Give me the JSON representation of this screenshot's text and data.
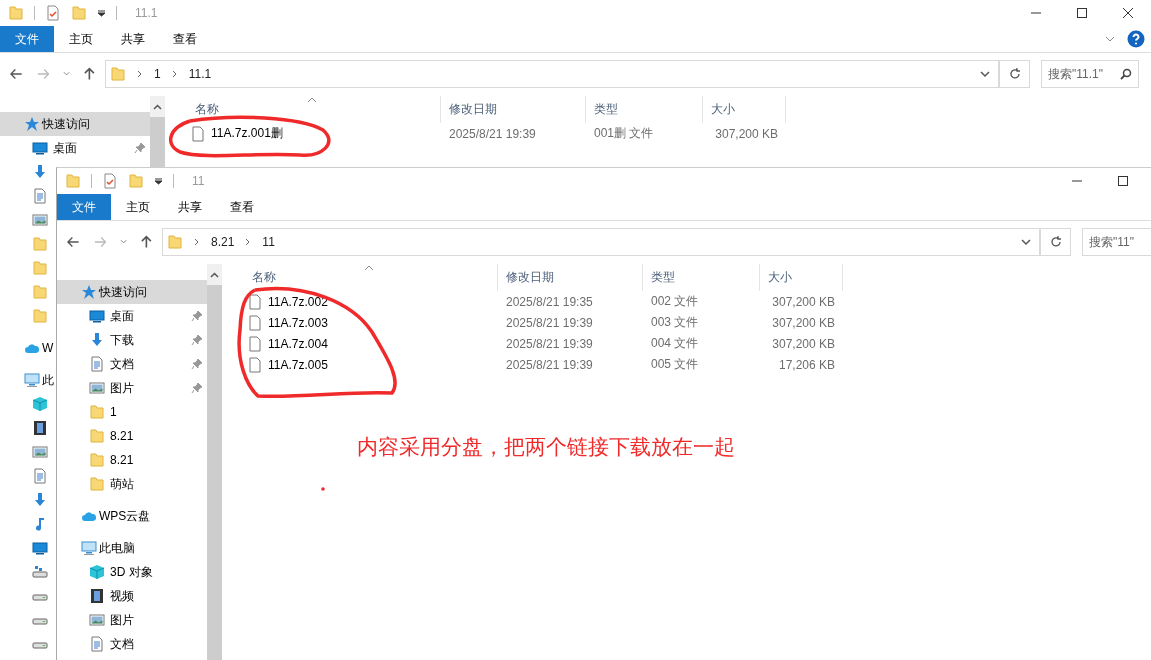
{
  "back_window": {
    "title": "11.1",
    "ribbon_controls": true,
    "ribbon_tabs": [
      {
        "label": "文件",
        "selected": true
      },
      {
        "label": "主页",
        "selected": false
      },
      {
        "label": "共享",
        "selected": false
      },
      {
        "label": "查看",
        "selected": false
      }
    ],
    "breadcrumb": [
      "1",
      "11.1"
    ],
    "search": {
      "placeholder": "搜索\"11.1\""
    },
    "nav": [
      {
        "kind": "star",
        "label": "快速访问",
        "selected": true,
        "children": [
          {
            "kind": "desktop",
            "label": "桌面",
            "selected": false,
            "pinned": true
          },
          {
            "kind": "download",
            "selected": false,
            "pinned": false
          },
          {
            "kind": "document",
            "selected": false,
            "pinned": false
          },
          {
            "kind": "picture",
            "selected": false,
            "pinned": false
          },
          {
            "kind": "folder",
            "selected": false,
            "pinned": false
          },
          {
            "kind": "folder",
            "selected": false,
            "pinned": false
          },
          {
            "kind": "folder",
            "selected": false,
            "pinned": false
          },
          {
            "kind": "folder",
            "selected": false,
            "pinned": false
          }
        ]
      },
      {
        "kind": "cloud",
        "label": "W",
        "selected": false
      },
      {
        "kind": "computer",
        "label": "此",
        "selected": false,
        "children": [
          {
            "kind": "cube",
            "selected": false
          },
          {
            "kind": "film",
            "selected": false
          },
          {
            "kind": "picture",
            "selected": false
          },
          {
            "kind": "document",
            "selected": false
          },
          {
            "kind": "download",
            "selected": false
          },
          {
            "kind": "music",
            "selected": false
          },
          {
            "kind": "desktop",
            "selected": false
          },
          {
            "kind": "network-drive",
            "selected": false
          },
          {
            "kind": "drive",
            "selected": false
          },
          {
            "kind": "drive",
            "selected": false
          },
          {
            "kind": "drive",
            "selected": false
          }
        ]
      }
    ],
    "columns": [
      "名称",
      "修改日期",
      "类型",
      "大小"
    ],
    "files": [
      {
        "name": "11A.7z.001删",
        "modified": "2025/8/21 19:39",
        "type": "001删 文件",
        "size": "307,200 KB"
      }
    ]
  },
  "front_window": {
    "title": "11",
    "ribbon_controls": false,
    "ribbon_tabs": [
      {
        "label": "文件",
        "selected": true
      },
      {
        "label": "主页",
        "selected": false
      },
      {
        "label": "共享",
        "selected": false
      },
      {
        "label": "查看",
        "selected": false
      }
    ],
    "breadcrumb": [
      "8.21",
      "11"
    ],
    "search": {
      "placeholder": "搜索\"11\""
    },
    "nav": [
      {
        "kind": "star",
        "label": "快速访问",
        "selected": true,
        "children": [
          {
            "kind": "desktop",
            "label": "桌面",
            "selected": false,
            "pinned": true
          },
          {
            "kind": "download",
            "label": "下载",
            "selected": false,
            "pinned": true
          },
          {
            "kind": "document",
            "label": "文档",
            "selected": false,
            "pinned": true
          },
          {
            "kind": "picture",
            "label": "图片",
            "selected": false,
            "pinned": true
          },
          {
            "kind": "folder",
            "label": "1",
            "selected": false,
            "pinned": false
          },
          {
            "kind": "folder",
            "label": "8.21",
            "selected": false,
            "pinned": false
          },
          {
            "kind": "folder",
            "label": "8.21",
            "selected": false,
            "pinned": false
          },
          {
            "kind": "folder",
            "label": "萌站",
            "selected": false,
            "pinned": false
          }
        ]
      },
      {
        "kind": "cloud",
        "label": "WPS云盘",
        "selected": false
      },
      {
        "kind": "computer",
        "label": "此电脑",
        "selected": false,
        "children": [
          {
            "kind": "cube",
            "label": "3D 对象",
            "selected": false
          },
          {
            "kind": "film",
            "label": "视频",
            "selected": false
          },
          {
            "kind": "picture",
            "label": "图片",
            "selected": false
          },
          {
            "kind": "document",
            "label": "文档",
            "selected": false
          }
        ]
      }
    ],
    "columns": [
      "名称",
      "修改日期",
      "类型",
      "大小"
    ],
    "files": [
      {
        "name": "11A.7z.002",
        "modified": "2025/8/21 19:35",
        "type": "002 文件",
        "size": "307,200 KB"
      },
      {
        "name": "11A.7z.003",
        "modified": "2025/8/21 19:39",
        "type": "003 文件",
        "size": "307,200 KB"
      },
      {
        "name": "11A.7z.004",
        "modified": "2025/8/21 19:39",
        "type": "004 文件",
        "size": "307,200 KB"
      },
      {
        "name": "11A.7z.005",
        "modified": "2025/8/21 19:39",
        "type": "005 文件",
        "size": "17,206 KB"
      }
    ]
  },
  "annotation": {
    "note": "内容采用分盘，把两个链接下载放在一起"
  }
}
